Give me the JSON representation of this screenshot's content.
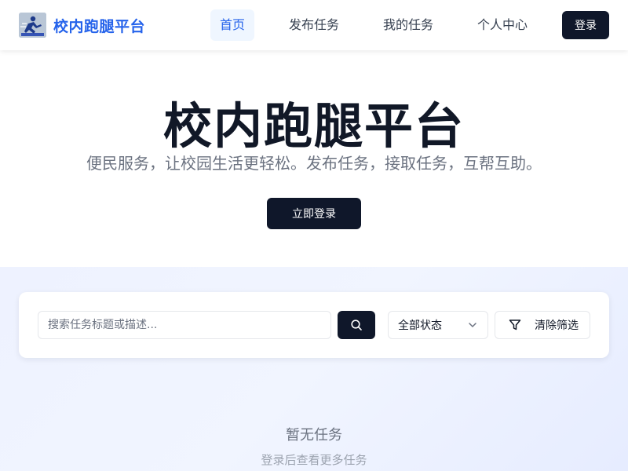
{
  "nav": {
    "brand": "校内跑腿平台",
    "links": [
      {
        "label": "首页",
        "active": true
      },
      {
        "label": "发布任务",
        "active": false
      },
      {
        "label": "我的任务",
        "active": false
      },
      {
        "label": "个人中心",
        "active": false
      }
    ],
    "login": "登录"
  },
  "hero": {
    "title": "校内跑腿平台",
    "subtitle": "便民服务，让校园生活更轻松。发布任务，接取任务，互帮互助。",
    "cta": "立即登录"
  },
  "filters": {
    "search_placeholder": "搜索任务标题或描述...",
    "status_selected": "全部状态",
    "clear": "清除筛选"
  },
  "empty": {
    "title": "暂无任务",
    "subtitle": "登录后查看更多任务"
  },
  "colors": {
    "brand": "#2563eb",
    "dark_button": "#0f172a",
    "active_nav_bg": "#eff6ff"
  }
}
